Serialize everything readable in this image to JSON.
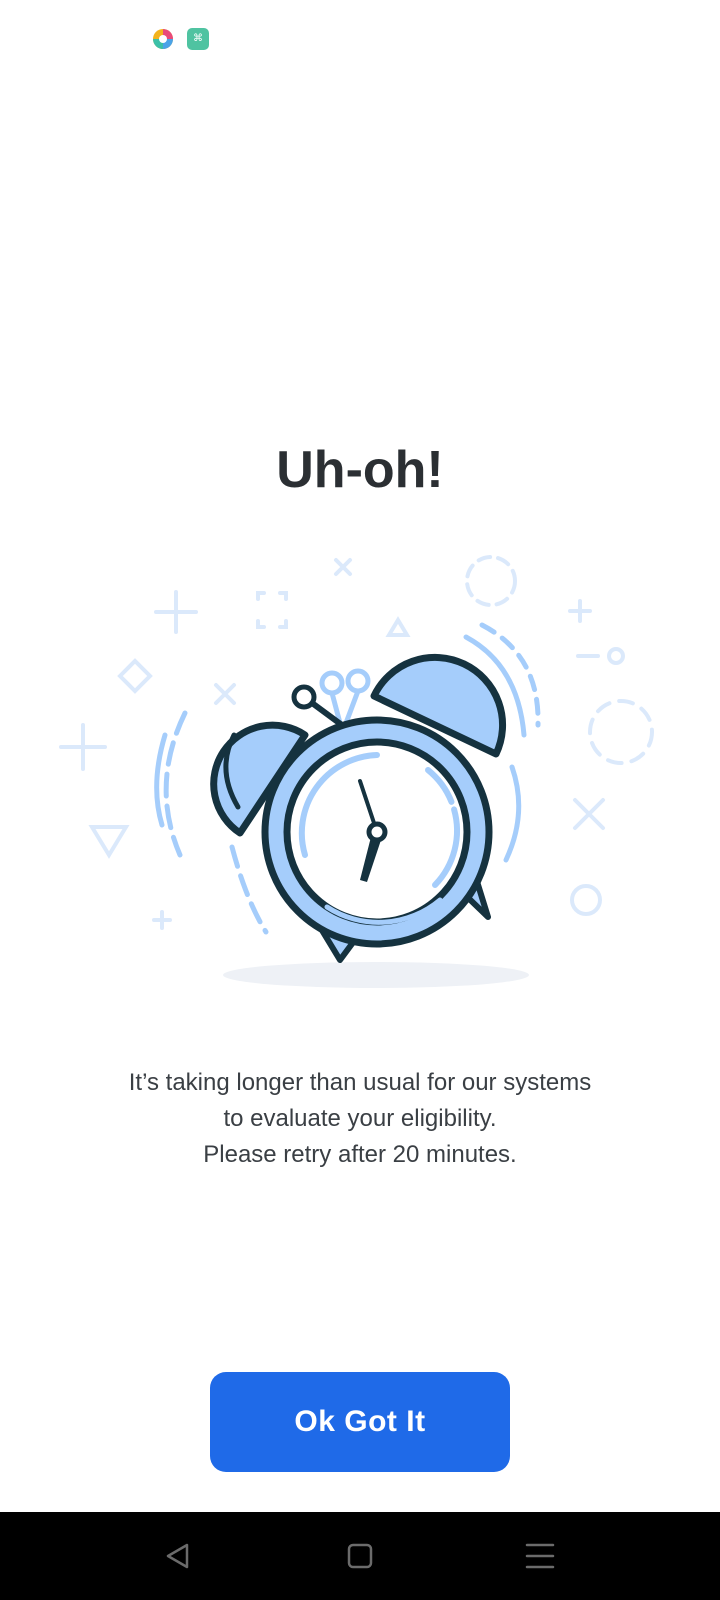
{
  "status_bar": {
    "icons": [
      "photos-app-icon",
      "green-app-icon"
    ],
    "green_app_glyph": "⌘"
  },
  "dialog": {
    "title": "Uh-oh!",
    "message_lines": [
      "It’s taking longer than usual for our systems",
      "to evaluate your eligibility.",
      "Please retry after 20 minutes."
    ],
    "button_label": "Ok Got It",
    "illustration": "alarm-clock-illustration"
  },
  "nav_bar": {
    "buttons": [
      "back-icon",
      "home-icon",
      "recents-icon"
    ]
  },
  "colors": {
    "accent": "#1f6ae8",
    "title_text": "#2b2f33",
    "body_text": "#3a3f44",
    "illustration_light": "#a5cdfb",
    "illustration_dark": "#15323f",
    "nav_background": "#000000"
  }
}
